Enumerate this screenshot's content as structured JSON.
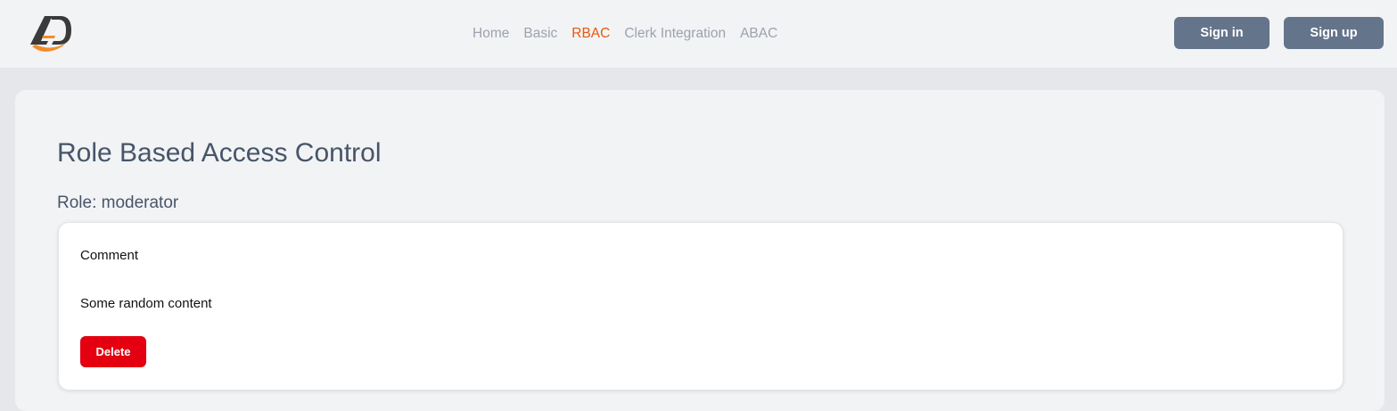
{
  "header": {
    "logo_text": "AD",
    "nav": [
      {
        "label": "Home",
        "active": false
      },
      {
        "label": "Basic",
        "active": false
      },
      {
        "label": "RBAC",
        "active": true
      },
      {
        "label": "Clerk Integration",
        "active": false
      },
      {
        "label": "ABAC",
        "active": false
      }
    ],
    "signin_label": "Sign in",
    "signup_label": "Sign up"
  },
  "main": {
    "title": "Role Based Access Control",
    "role_line": "Role: moderator",
    "card": {
      "title": "Comment",
      "content": "Some random content",
      "delete_label": "Delete"
    }
  },
  "colors": {
    "accent": "#ea580c",
    "button": "#64748b",
    "danger": "#e40010"
  }
}
